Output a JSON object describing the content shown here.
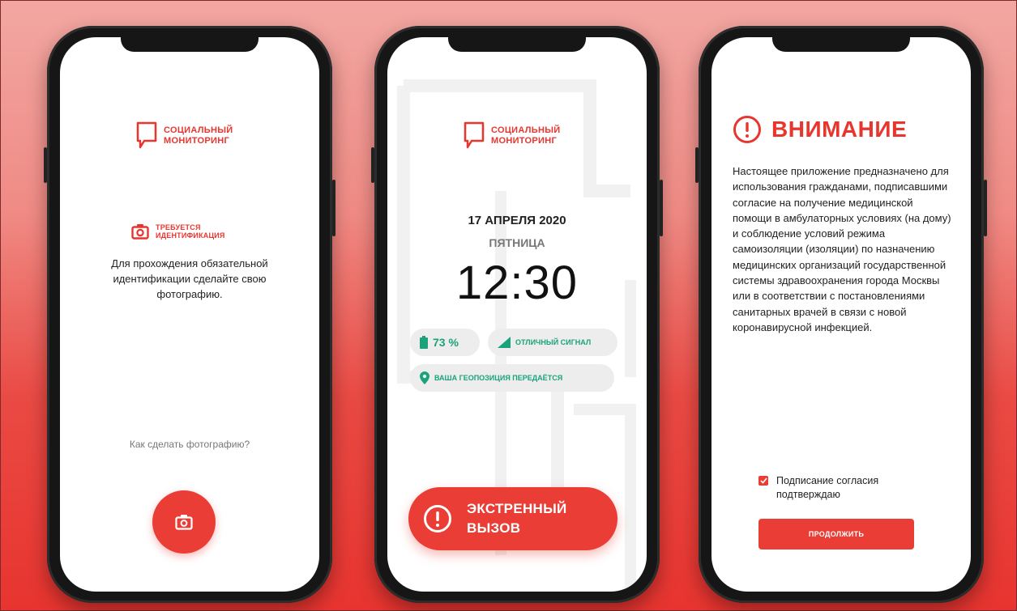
{
  "brand": {
    "name_line1": "СОЦИАЛЬНЫЙ",
    "name_line2": "МОНИТОРИНГ",
    "accent_color": "#e8362f",
    "success_color": "#1aa37a",
    "icon": "speech-bubble-icon"
  },
  "screen1": {
    "requirement_line1": "ТРЕБУЕТСЯ",
    "requirement_line2": "ИДЕНТИФИКАЦИЯ",
    "requirement_icon": "camera-icon",
    "instruction": "Для прохождения обязательной идентификации сделайте свою фотографию.",
    "howto_link": "Как сделать фотографию?",
    "camera_button_icon": "camera-icon"
  },
  "screen2": {
    "date": "17 АПРЕЛЯ 2020",
    "weekday": "ПЯТНИЦА",
    "time": "12:30",
    "battery": {
      "icon": "battery-icon",
      "percent": "73 %"
    },
    "signal": {
      "icon": "signal-icon",
      "label": "ОТЛИЧНЫЙ СИГНАЛ"
    },
    "geo": {
      "icon": "location-pin-icon",
      "label": "ВАША ГЕОПОЗИЦИЯ ПЕРЕДАЁТСЯ"
    },
    "emergency": {
      "icon": "alert-circle-icon",
      "line1": "ЭКСТРЕННЫЙ",
      "line2": "ВЫЗОВ"
    }
  },
  "screen3": {
    "title": "ВНИМАНИЕ",
    "title_icon": "alert-circle-icon",
    "body": "Настоящее приложение предназначено для использования гражданами, подписавшими согласие на получение медицинской помощи в амбулаторных условиях (на дому) и соблюдение условий режима самоизоляции (изоляции) по назначению медицинских организаций государственной системы здравоохранения города Москвы или в соответствии с постановлениями санитарных врачей в связи с новой коронавирусной инфекцией.",
    "consent_label": "Подписание согласия подтверждаю",
    "consent_checked": true,
    "continue_label": "ПРОДОЛЖИТЬ"
  }
}
